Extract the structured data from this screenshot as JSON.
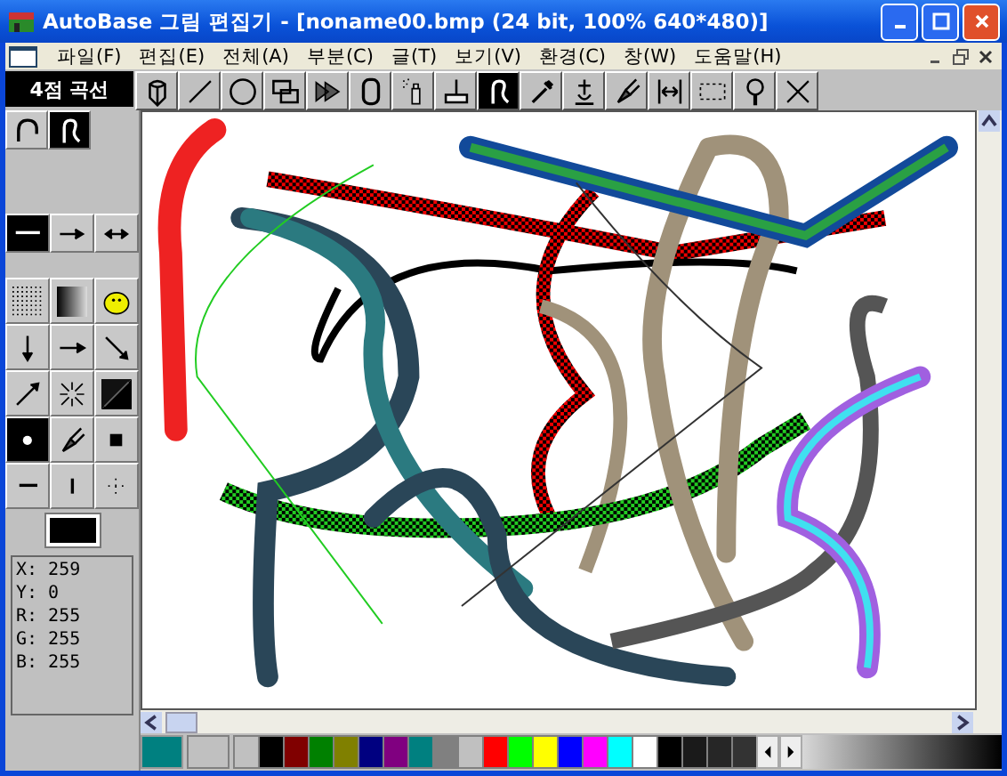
{
  "window": {
    "title": "AutoBase 그림 편집기 - [noname00.bmp (24 bit, 100% 640*480)]"
  },
  "menu": [
    "파일(F)",
    "편집(E)",
    "전체(A)",
    "부분(C)",
    "글(T)",
    "보기(V)",
    "환경(C)",
    "창(W)",
    "도움말(H)"
  ],
  "tool_label": "4점 곡선",
  "toolbar": [
    {
      "kind": "pencil",
      "selected": false
    },
    {
      "kind": "line",
      "selected": false
    },
    {
      "kind": "circle",
      "selected": false
    },
    {
      "kind": "rects",
      "selected": false
    },
    {
      "kind": "shape",
      "selected": false
    },
    {
      "kind": "roundrect",
      "selected": false
    },
    {
      "kind": "spray",
      "selected": false
    },
    {
      "kind": "roller",
      "selected": false
    },
    {
      "kind": "curve",
      "selected": true
    },
    {
      "kind": "dropper",
      "selected": false
    },
    {
      "kind": "stamp",
      "selected": false
    },
    {
      "kind": "brush",
      "selected": false
    },
    {
      "kind": "resize",
      "selected": false
    },
    {
      "kind": "select",
      "selected": false
    },
    {
      "kind": "zoom",
      "selected": false
    },
    {
      "kind": "cross",
      "selected": false
    }
  ],
  "curve_modes": [
    {
      "kind": "arc",
      "selected": false
    },
    {
      "kind": "curve",
      "selected": true
    }
  ],
  "line_styles": [
    {
      "kind": "plain",
      "selected": true
    },
    {
      "kind": "arrow",
      "selected": false
    },
    {
      "kind": "double",
      "selected": false
    }
  ],
  "fills": [
    {
      "kind": "dots",
      "selected": false
    },
    {
      "kind": "gradient",
      "selected": false
    },
    {
      "kind": "picture",
      "selected": false
    }
  ],
  "directions": [
    {
      "kind": "down",
      "selected": false
    },
    {
      "kind": "right",
      "selected": false
    },
    {
      "kind": "diag-down",
      "selected": false
    },
    {
      "kind": "diag-up",
      "selected": false
    },
    {
      "kind": "center",
      "selected": false
    },
    {
      "kind": "corner",
      "selected": false
    }
  ],
  "brushes": [
    {
      "kind": "dot",
      "selected": true
    },
    {
      "kind": "brush",
      "selected": false
    },
    {
      "kind": "square",
      "selected": false
    },
    {
      "kind": "hline",
      "selected": false
    },
    {
      "kind": "vline",
      "selected": false
    },
    {
      "kind": "scatter",
      "selected": false
    }
  ],
  "info": [
    "X: 259",
    "Y: 0",
    "R: 255",
    "G: 255",
    "B: 255"
  ],
  "palette": [
    {
      "color": "#c0c0c0"
    },
    {
      "color": "#000000"
    },
    {
      "color": "#800000"
    },
    {
      "color": "#008000"
    },
    {
      "color": "#808000"
    },
    {
      "color": "#000080"
    },
    {
      "color": "#800080"
    },
    {
      "color": "#008080"
    },
    {
      "color": "#808080"
    },
    {
      "color": "#c0c0c0"
    },
    {
      "color": "#ff0000"
    },
    {
      "color": "#00ff00"
    },
    {
      "color": "#ffff00"
    },
    {
      "color": "#0000ff"
    },
    {
      "color": "#ff00ff"
    },
    {
      "color": "#00ffff"
    },
    {
      "color": "#ffffff"
    },
    {
      "color": "#000000"
    },
    {
      "color": "#1a1a1a"
    },
    {
      "color": "#262626"
    },
    {
      "color": "#333333"
    }
  ]
}
